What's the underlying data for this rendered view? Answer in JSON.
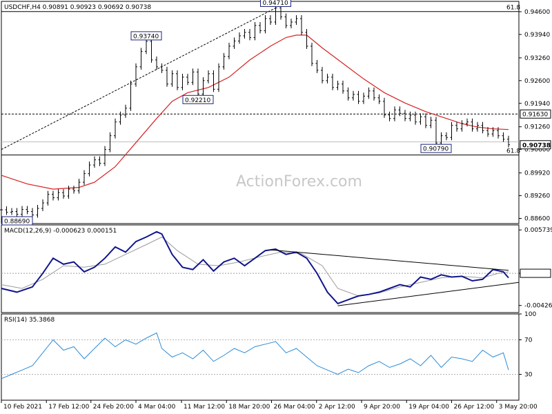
{
  "chart_data": [
    {
      "type": "line",
      "name": "price",
      "header": "USDCHF,H4  0.90891 0.90923 0.90692 0.90738",
      "watermark": "ActionForex.com",
      "ylim": [
        0.8845,
        0.949
      ],
      "y_ticks": [
        "0.94600",
        "0.93940",
        "0.93260",
        "0.92600",
        "0.91940",
        "0.91260",
        "0.90600",
        "0.89920",
        "0.89260",
        "0.88600"
      ],
      "y_tick_values": [
        0.946,
        0.9394,
        0.9326,
        0.926,
        0.9194,
        0.9126,
        0.906,
        0.8992,
        0.8926,
        0.886
      ],
      "x_labels": [
        "10 Feb 2021",
        "17 Feb 12:00",
        "24 Feb 20:00",
        "4 Mar 04:00",
        "11 Mar 12:00",
        "18 Mar 20:00",
        "26 Mar 04:00",
        "2 Apr 12:00",
        "9 Apr 20:00",
        "19 Apr 04:00",
        "26 Apr 12:00",
        "3 May 20:00"
      ],
      "xlim": [
        0,
        100
      ],
      "x_label_positions": [
        0,
        8.7,
        17.3,
        26.0,
        34.8,
        43.5,
        52.2,
        60.9,
        69.6,
        78.3,
        87.0,
        95.7
      ],
      "price_close": [
        [
          0,
          0.8885
        ],
        [
          1,
          0.8878
        ],
        [
          2,
          0.888
        ],
        [
          3,
          0.8872
        ],
        [
          4,
          0.8886
        ],
        [
          5,
          0.888
        ],
        [
          6,
          0.887
        ],
        [
          7,
          0.8889
        ],
        [
          8,
          0.8905
        ],
        [
          9,
          0.893
        ],
        [
          10,
          0.892
        ],
        [
          11,
          0.8935
        ],
        [
          12,
          0.8925
        ],
        [
          13,
          0.8945
        ],
        [
          14,
          0.894
        ],
        [
          15,
          0.8965
        ],
        [
          16,
          0.899
        ],
        [
          17,
          0.9015
        ],
        [
          18,
          0.903
        ],
        [
          19,
          0.902
        ],
        [
          20,
          0.906
        ],
        [
          21,
          0.91
        ],
        [
          22,
          0.914
        ],
        [
          23,
          0.916
        ],
        [
          24,
          0.918
        ],
        [
          25,
          0.925
        ],
        [
          26,
          0.93
        ],
        [
          27,
          0.9345
        ],
        [
          28,
          0.9374
        ],
        [
          29,
          0.932
        ],
        [
          30,
          0.93
        ],
        [
          31,
          0.929
        ],
        [
          32,
          0.925
        ],
        [
          33,
          0.928
        ],
        [
          34,
          0.924
        ],
        [
          35,
          0.927
        ],
        [
          36,
          0.9255
        ],
        [
          37,
          0.9285
        ],
        [
          38,
          0.9221
        ],
        [
          39,
          0.926
        ],
        [
          40,
          0.928
        ],
        [
          41,
          0.9235
        ],
        [
          42,
          0.93
        ],
        [
          43,
          0.933
        ],
        [
          44,
          0.936
        ],
        [
          45,
          0.9375
        ],
        [
          46,
          0.939
        ],
        [
          47,
          0.94
        ],
        [
          48,
          0.9385
        ],
        [
          49,
          0.942
        ],
        [
          50,
          0.9405
        ],
        [
          51,
          0.944
        ],
        [
          52,
          0.943
        ],
        [
          53,
          0.9471
        ],
        [
          54,
          0.9445
        ],
        [
          55,
          0.942
        ],
        [
          56,
          0.943
        ],
        [
          57,
          0.944
        ],
        [
          58,
          0.94
        ],
        [
          59,
          0.936
        ],
        [
          60,
          0.931
        ],
        [
          61,
          0.929
        ],
        [
          62,
          0.926
        ],
        [
          63,
          0.927
        ],
        [
          64,
          0.924
        ],
        [
          65,
          0.925
        ],
        [
          66,
          0.923
        ],
        [
          67,
          0.921
        ],
        [
          68,
          0.922
        ],
        [
          69,
          0.92
        ],
        [
          70,
          0.9215
        ],
        [
          71,
          0.923
        ],
        [
          72,
          0.921
        ],
        [
          73,
          0.92
        ],
        [
          74,
          0.916
        ],
        [
          75,
          0.915
        ],
        [
          76,
          0.9175
        ],
        [
          77,
          0.9165
        ],
        [
          78,
          0.915
        ],
        [
          79,
          0.916
        ],
        [
          80,
          0.914
        ],
        [
          81,
          0.9155
        ],
        [
          82,
          0.913
        ],
        [
          83,
          0.9145
        ],
        [
          84,
          0.9079
        ],
        [
          85,
          0.91
        ],
        [
          86,
          0.9095
        ],
        [
          87,
          0.913
        ],
        [
          88,
          0.912
        ],
        [
          89,
          0.9135
        ],
        [
          90,
          0.914
        ],
        [
          91,
          0.912
        ],
        [
          92,
          0.913
        ],
        [
          93,
          0.9115
        ],
        [
          94,
          0.9105
        ],
        [
          95,
          0.9115
        ],
        [
          96,
          0.91
        ],
        [
          97,
          0.909
        ],
        [
          98,
          0.9074
        ]
      ],
      "ma_line": [
        [
          0,
          0.8985
        ],
        [
          5,
          0.896
        ],
        [
          10,
          0.8945
        ],
        [
          15,
          0.895
        ],
        [
          18,
          0.8965
        ],
        [
          22,
          0.901
        ],
        [
          26,
          0.908
        ],
        [
          30,
          0.915
        ],
        [
          33,
          0.92
        ],
        [
          36,
          0.9225
        ],
        [
          40,
          0.924
        ],
        [
          44,
          0.927
        ],
        [
          48,
          0.932
        ],
        [
          52,
          0.936
        ],
        [
          55,
          0.9385
        ],
        [
          57,
          0.9392
        ],
        [
          59,
          0.9392
        ],
        [
          62,
          0.9355
        ],
        [
          66,
          0.931
        ],
        [
          70,
          0.9265
        ],
        [
          74,
          0.9225
        ],
        [
          78,
          0.9195
        ],
        [
          82,
          0.917
        ],
        [
          86,
          0.915
        ],
        [
          89,
          0.9135
        ],
        [
          92,
          0.9125
        ],
        [
          95,
          0.912
        ],
        [
          98,
          0.9118
        ]
      ],
      "trendline": [
        [
          0,
          0.906
        ],
        [
          53,
          0.9471
        ]
      ],
      "hlines": [
        {
          "value": 0.94605,
          "label": "61.8",
          "style": "solid"
        },
        {
          "value": 0.9163,
          "label": "",
          "style": "dashed"
        },
        {
          "value": 0.9082,
          "label": "",
          "style": "solid-gray"
        },
        {
          "value": 0.9044,
          "label": "61.8",
          "style": "solid"
        }
      ],
      "point_labels": [
        {
          "x": 0,
          "y": 0.8869,
          "text": "0.88690",
          "anchor": "below"
        },
        {
          "x": 28,
          "y": 0.9374,
          "text": "0.93740",
          "anchor": "above"
        },
        {
          "x": 38,
          "y": 0.9221,
          "text": "0.92210",
          "anchor": "below"
        },
        {
          "x": 53,
          "y": 0.9471,
          "text": "0.94710",
          "anchor": "above"
        },
        {
          "x": 84,
          "y": 0.9079,
          "text": "0.90790",
          "anchor": "below"
        }
      ],
      "price_tags": [
        {
          "value": 0.9163,
          "text": "0.91630"
        },
        {
          "value": 0.90738,
          "text": "0.90738"
        }
      ],
      "colors": {
        "price": "#000000",
        "ma": "#d62020",
        "trend": "#000000",
        "tag_border": "#000000"
      }
    },
    {
      "type": "line",
      "name": "macd",
      "header": "MACD(12,26,9) -0.000623 0.000151",
      "ylim": [
        -0.0052,
        0.0064
      ],
      "y_ticks": [
        "0.005739",
        "0.0",
        "-0.004261"
      ],
      "y_tick_values": [
        0.005739,
        0.0,
        -0.004261
      ],
      "zero_tag": "0.0",
      "macd": [
        [
          0,
          -0.002
        ],
        [
          3,
          -0.0025
        ],
        [
          6,
          -0.0018
        ],
        [
          8,
          0.0
        ],
        [
          10,
          0.002
        ],
        [
          12,
          0.0012
        ],
        [
          14,
          0.0015
        ],
        [
          16,
          0.0002
        ],
        [
          18,
          0.0008
        ],
        [
          20,
          0.002
        ],
        [
          22,
          0.0035
        ],
        [
          24,
          0.0028
        ],
        [
          26,
          0.0042
        ],
        [
          28,
          0.0048
        ],
        [
          30,
          0.0055
        ],
        [
          31,
          0.0052
        ],
        [
          33,
          0.0025
        ],
        [
          35,
          0.0008
        ],
        [
          37,
          0.0005
        ],
        [
          39,
          0.0018
        ],
        [
          41,
          0.0003
        ],
        [
          43,
          0.0015
        ],
        [
          45,
          0.002
        ],
        [
          47,
          0.001
        ],
        [
          49,
          0.002
        ],
        [
          51,
          0.003
        ],
        [
          53,
          0.0032
        ],
        [
          55,
          0.0025
        ],
        [
          57,
          0.0028
        ],
        [
          59,
          0.002
        ],
        [
          61,
          0.0
        ],
        [
          63,
          -0.0025
        ],
        [
          65,
          -0.004
        ],
        [
          67,
          -0.0035
        ],
        [
          69,
          -0.003
        ],
        [
          71,
          -0.0028
        ],
        [
          73,
          -0.0025
        ],
        [
          75,
          -0.002
        ],
        [
          77,
          -0.0015
        ],
        [
          79,
          -0.0018
        ],
        [
          81,
          -0.0005
        ],
        [
          83,
          -0.0008
        ],
        [
          85,
          -0.0002
        ],
        [
          87,
          -0.0005
        ],
        [
          89,
          -0.0004
        ],
        [
          91,
          -0.001
        ],
        [
          93,
          -0.0008
        ],
        [
          95,
          0.0005
        ],
        [
          97,
          0.0002
        ],
        [
          98,
          -0.0006
        ]
      ],
      "signal": [
        [
          0,
          -0.0015
        ],
        [
          4,
          -0.002
        ],
        [
          8,
          -0.0008
        ],
        [
          12,
          0.001
        ],
        [
          16,
          0.0008
        ],
        [
          20,
          0.0012
        ],
        [
          24,
          0.0025
        ],
        [
          28,
          0.0038
        ],
        [
          31,
          0.0048
        ],
        [
          34,
          0.003
        ],
        [
          38,
          0.0012
        ],
        [
          42,
          0.001
        ],
        [
          46,
          0.0015
        ],
        [
          50,
          0.0022
        ],
        [
          54,
          0.0028
        ],
        [
          58,
          0.0026
        ],
        [
          62,
          0.001
        ],
        [
          65,
          -0.002
        ],
        [
          69,
          -0.003
        ],
        [
          73,
          -0.0026
        ],
        [
          77,
          -0.0018
        ],
        [
          81,
          -0.0012
        ],
        [
          85,
          -0.0006
        ],
        [
          89,
          -0.0004
        ],
        [
          93,
          -0.0006
        ],
        [
          96,
          0.0
        ],
        [
          98,
          0.0002
        ]
      ],
      "trendlines": [
        [
          [
            52,
            0.0031
          ],
          [
            98,
            0.0004
          ]
        ],
        [
          [
            65,
            -0.0043
          ],
          [
            100,
            -0.0012
          ]
        ]
      ],
      "colors": {
        "macd": "#10148c",
        "signal": "#9a9a9a",
        "trend": "#000000"
      }
    },
    {
      "type": "line",
      "name": "rsi",
      "header": "RSI(14) 35.3868",
      "ylim": [
        0,
        100
      ],
      "y_ticks": [
        "100",
        "70",
        "30"
      ],
      "y_tick_values": [
        100,
        70,
        30
      ],
      "rsi": [
        [
          0,
          25
        ],
        [
          2,
          30
        ],
        [
          4,
          35
        ],
        [
          6,
          40
        ],
        [
          8,
          55
        ],
        [
          10,
          70
        ],
        [
          12,
          58
        ],
        [
          14,
          62
        ],
        [
          16,
          48
        ],
        [
          18,
          60
        ],
        [
          20,
          72
        ],
        [
          22,
          62
        ],
        [
          24,
          70
        ],
        [
          26,
          65
        ],
        [
          28,
          72
        ],
        [
          30,
          78
        ],
        [
          31,
          60
        ],
        [
          33,
          50
        ],
        [
          35,
          55
        ],
        [
          37,
          48
        ],
        [
          39,
          58
        ],
        [
          41,
          45
        ],
        [
          43,
          52
        ],
        [
          45,
          60
        ],
        [
          47,
          55
        ],
        [
          49,
          62
        ],
        [
          51,
          65
        ],
        [
          53,
          68
        ],
        [
          55,
          55
        ],
        [
          57,
          60
        ],
        [
          59,
          50
        ],
        [
          61,
          40
        ],
        [
          63,
          35
        ],
        [
          65,
          30
        ],
        [
          67,
          36
        ],
        [
          69,
          32
        ],
        [
          71,
          40
        ],
        [
          73,
          45
        ],
        [
          75,
          38
        ],
        [
          77,
          42
        ],
        [
          79,
          48
        ],
        [
          81,
          40
        ],
        [
          83,
          52
        ],
        [
          85,
          38
        ],
        [
          87,
          50
        ],
        [
          89,
          48
        ],
        [
          91,
          45
        ],
        [
          93,
          58
        ],
        [
          95,
          50
        ],
        [
          97,
          55
        ],
        [
          98,
          35
        ]
      ],
      "color": "#2b8bd8"
    }
  ]
}
